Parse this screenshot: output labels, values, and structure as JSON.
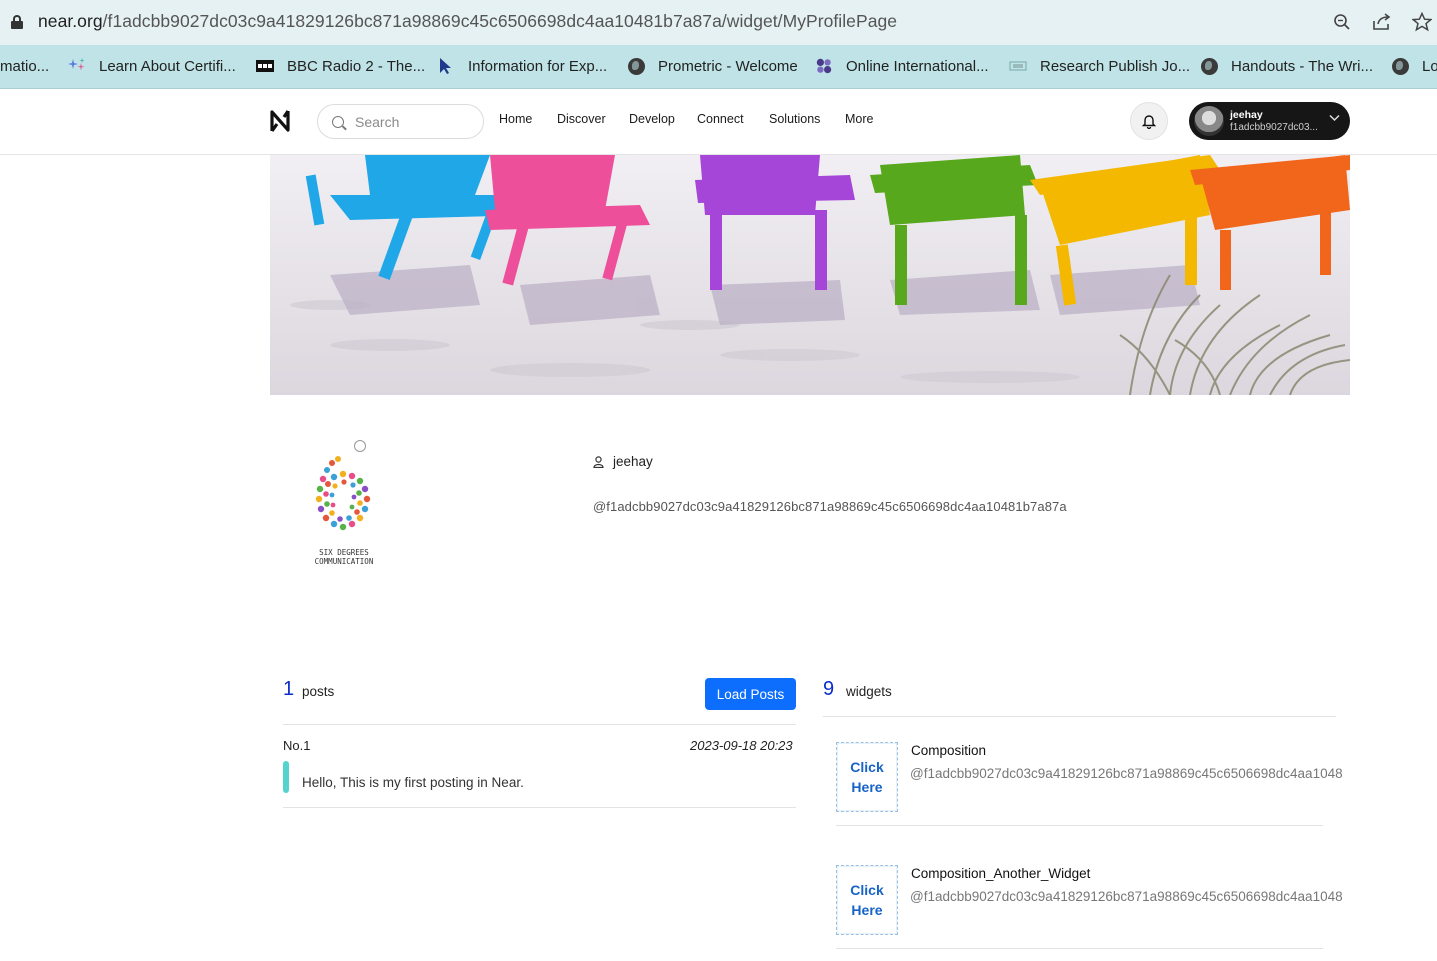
{
  "browser": {
    "url_host": "near.org",
    "url_path": "/f1adcbb9027dc03c9a41829126bc871a98869c45c6506698dc4aa10481b7a87a/widget/MyProfilePage",
    "bookmarks": [
      {
        "label": "matio..."
      },
      {
        "label": "Learn About Certifi..."
      },
      {
        "label": "BBC Radio 2 - The..."
      },
      {
        "label": "Information for Exp..."
      },
      {
        "label": "Prometric - Welcome"
      },
      {
        "label": "Online International..."
      },
      {
        "label": "Research Publish Jo..."
      },
      {
        "label": "Handouts - The Wri..."
      },
      {
        "label": "Lo"
      }
    ]
  },
  "header": {
    "search_placeholder": "Search",
    "nav": [
      "Home",
      "Discover",
      "Develop",
      "Connect",
      "Solutions",
      "More"
    ],
    "account": {
      "name": "jeehay",
      "id": "f1adcbb9027dc03..."
    }
  },
  "profile": {
    "logo_caption_line1": "SIX DEGREES",
    "logo_caption_line2": "COMMUNICATION",
    "username": "jeehay",
    "handle": "@f1adcbb9027dc03c9a41829126bc871a98869c45c6506698dc4aa10481b7a87a"
  },
  "posts": {
    "count": "1",
    "label": "posts",
    "load_button": "Load Posts",
    "items": [
      {
        "no": "No.1",
        "date": "2023-09-18 20:23",
        "text": "Hello, This is my first posting in Near."
      }
    ]
  },
  "widgets": {
    "count": "9",
    "label": "widgets",
    "click_label_1": "Click",
    "click_label_2": "Here",
    "items": [
      {
        "name": "Composition",
        "src": "@f1adcbb9027dc03c9a41829126bc871a98869c45c6506698dc4aa1048"
      },
      {
        "name": "Composition_Another_Widget",
        "src": "@f1adcbb9027dc03c9a41829126bc871a98869c45c6506698dc4aa1048"
      }
    ]
  },
  "colors": {
    "accent": "#0d6efd",
    "count_blue": "#0b2dcc",
    "post_bar": "#57d3cf",
    "url_bar": "#e6f1f3",
    "bookmarks_bar": "#bfe3e6"
  }
}
